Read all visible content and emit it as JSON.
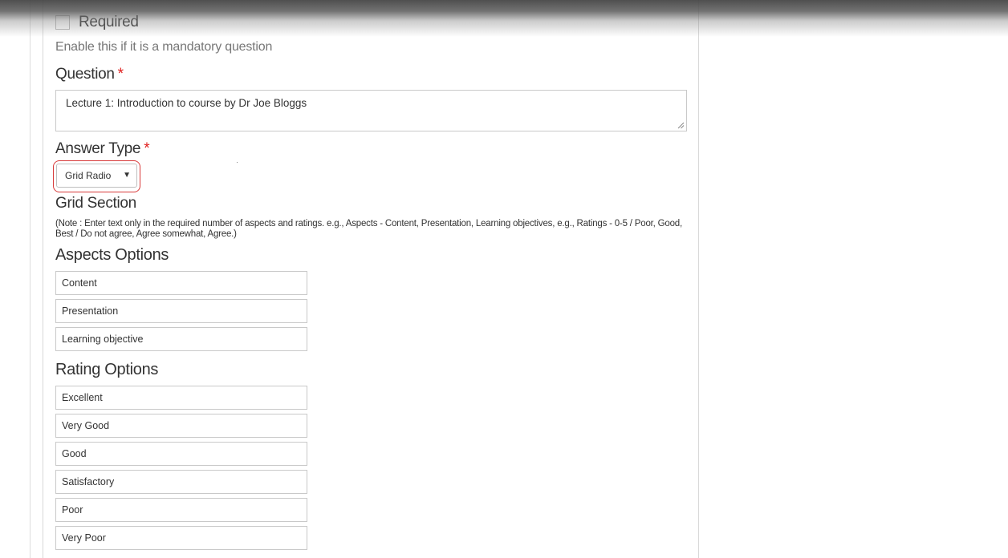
{
  "required": {
    "label": "Required",
    "checked": false,
    "hint": "Enable this if it is a mandatory question"
  },
  "question": {
    "label": "Question",
    "required_mark": "*",
    "value": "Lecture 1:  Introduction to course by Dr Joe Bloggs"
  },
  "answer_type": {
    "label": "Answer Type",
    "required_mark": "*",
    "selected": "Grid Radio",
    "arrow_icon": "caret-down-icon"
  },
  "grid_section": {
    "title": "Grid Section",
    "note": "(Note : Enter text only in the required number of aspects and ratings. e.g., Aspects - Content, Presentation, Learning objectives, e.g., Ratings - 0-5 / Poor, Good, Best / Do not agree, Agree somewhat, Agree.)"
  },
  "aspects": {
    "title": "Aspects Options",
    "options": [
      "Content",
      "Presentation",
      "Learning objective"
    ]
  },
  "ratings": {
    "title": "Rating Options",
    "options": [
      "Excellent",
      "Very Good",
      "Good",
      "Satisfactory",
      "Poor",
      "Very Poor"
    ]
  },
  "colors": {
    "required_star": "#e0201f",
    "highlight": "#d83a3a",
    "border": "#c9c9c9"
  }
}
